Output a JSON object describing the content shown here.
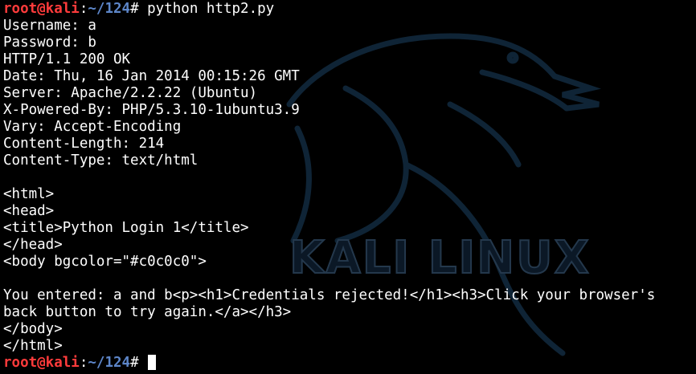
{
  "prompt": {
    "user_host": "root@kali",
    "colon": ":",
    "cwd": "~/124",
    "symbol": "#",
    "user_color": "#ff3b3b",
    "path_color": "#5d86c9"
  },
  "command": " python http2.py",
  "output_lines": [
    "Username: a",
    "Password: b",
    "HTTP/1.1 200 OK",
    "Date: Thu, 16 Jan 2014 00:15:26 GMT",
    "Server: Apache/2.2.22 (Ubuntu)",
    "X-Powered-By: PHP/5.3.10-1ubuntu3.9",
    "Vary: Accept-Encoding",
    "Content-Length: 214",
    "Content-Type: text/html",
    "",
    "<html>",
    "<head>",
    "<title>Python Login 1</title>",
    "</head>",
    "<body bgcolor=\"#c0c0c0\">",
    "",
    "You entered: a and b<p><h1>Credentials rejected!</h1><h3>Click your browser's",
    "back button to try again.</a></h3>",
    "</body>",
    "</html>"
  ],
  "final_prompt_input": " ",
  "wallpaper": {
    "logo_text": "KALI LINUX",
    "logo_icon": "kali-dragon-icon"
  },
  "colors": {
    "background": "#000000",
    "text": "#ffffff"
  }
}
